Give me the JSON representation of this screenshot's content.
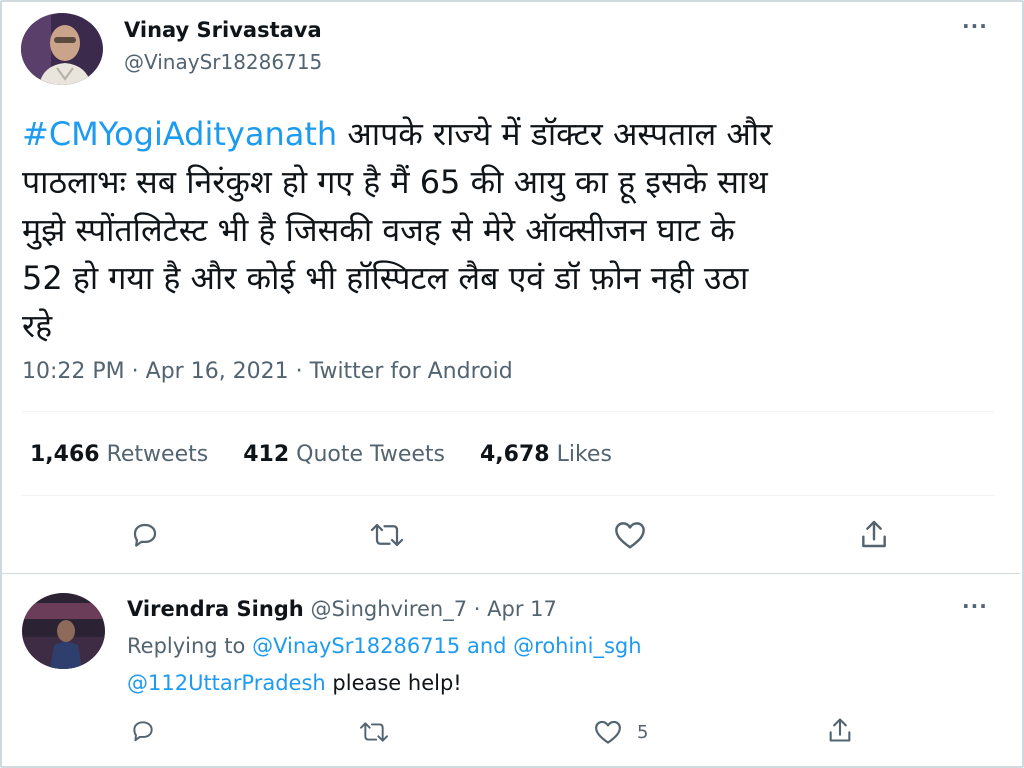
{
  "tweet": {
    "author_name": "Vinay Srivastava",
    "author_handle": "@VinaySr18286715",
    "more_label": "···",
    "hashtag": "#CMYogiAdityanath",
    "text_line1": " आपके राज्ये में डॉक्टर अस्पताल और",
    "text_line2": "पाठलाभः सब निरंकुश हो गए है मैं 65 की आयु का हू इसके साथ",
    "text_line3": "मुझे स्पोंतलिटेस्ट  भी है जिसकी वजह से मेरे ऑक्सीजन घाट के",
    "text_line4": "52 हो गया है और कोई भी हॉस्पिटल लैब एवं डॉ फ़ोन नही उठा",
    "text_line5": "रहे",
    "time": "10:22 PM",
    "date": "Apr 16, 2021",
    "source": "Twitter for Android",
    "separator": " · ",
    "stats": {
      "retweets_count": "1,466",
      "retweets_label": "Retweets",
      "quotes_count": "412",
      "quotes_label": "Quote Tweets",
      "likes_count": "4,678",
      "likes_label": "Likes"
    },
    "actions": [
      "reply-icon",
      "retweet-icon",
      "like-icon",
      "share-icon"
    ]
  },
  "reply": {
    "author_name": "Virendra Singh",
    "author_handle": "@Singhviren_7",
    "separator": " · ",
    "date": "Apr 17",
    "more_label": "···",
    "replying_prefix": "Replying to ",
    "mention1": "@VinaySr18286715",
    "and_word": " and ",
    "mention2": "@rohini_sgh",
    "mention3": "@112UttarPradesh",
    "text": " please help!",
    "like_count": "5"
  },
  "colors": {
    "accent": "#1d9bf0",
    "secondary_text": "#536471",
    "primary_text": "#0f1419",
    "divider": "#eff3f4"
  }
}
